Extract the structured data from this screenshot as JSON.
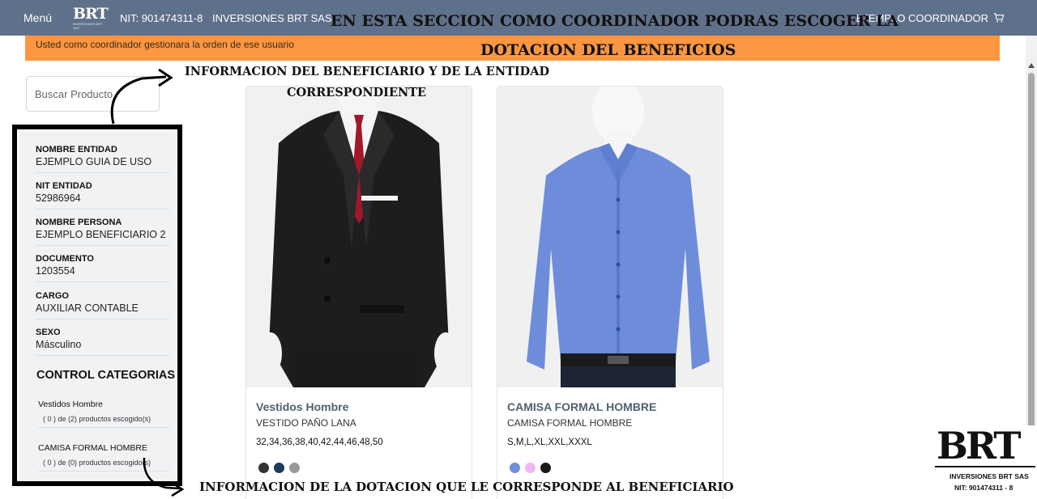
{
  "navbar": {
    "menu_label": "Menú",
    "logo_text": "BRT",
    "logo_subtext": "INVERSIONES BRT SAS",
    "nit": "NIT: 901474311-8",
    "company": "INVERSIONES BRT SAS",
    "user": "EJEMPLO COORDINADOR",
    "cart_icon": "cart-icon"
  },
  "banner": {
    "text": "Usted como coordinador gestionara la orden de ese usuario",
    "color": "#fd9640"
  },
  "search": {
    "placeholder": "Buscar Producto"
  },
  "sidebar": {
    "fields": [
      {
        "label": "NOMBRE ENTIDAD",
        "value": "EJEMPLO GUIA DE USO"
      },
      {
        "label": "NIT ENTIDAD",
        "value": "52986964"
      },
      {
        "label": "NOMBRE PERSONA",
        "value": "EJEMPLO BENEFICIARIO 2"
      },
      {
        "label": "DOCUMENTO",
        "value": "1203554"
      },
      {
        "label": "CARGO",
        "value": "AUXILIAR CONTABLE"
      },
      {
        "label": "SEXO",
        "value": "Másculino"
      }
    ],
    "categories_heading": "CONTROL CATEGORIAS",
    "categories": [
      {
        "name": "Vestidos Hombre",
        "count": "( 0 ) de (2) productos escogido(s)"
      },
      {
        "name": "CAMISA FORMAL HOMBRE",
        "count": "( 0 ) de (0) productos escogido(s)"
      }
    ]
  },
  "products": [
    {
      "title": "Vestidos Hombre",
      "subtitle": "VESTIDO PAÑO LANA",
      "sizes": "32,34,36,38,40,42,44,46,48,50",
      "colors": [
        "#333333",
        "#1e3a5f",
        "#9a9a9a"
      ]
    },
    {
      "title": "CAMISA FORMAL HOMBRE",
      "subtitle": "CAMISA FORMAL HOMBRE",
      "sizes": "S,M,L,XL,XXL,XXXL",
      "colors": [
        "#6f8fd8",
        "#f0b6f0",
        "#1a1a1a"
      ]
    }
  ],
  "annotations": {
    "top_line1": "EN ESTA SECCION COMO COORDINADOR PODRAS ESCOGER LA",
    "top_line2": "DOTACION DEL BENEFICIOS",
    "mid_line1": "INFORMACION DEL BENEFICIARIO Y DE LA ENTIDAD",
    "mid_line2": "CORRESPONDIENTE",
    "bottom": "INFORMACION DE LA DOTACION QUE LE CORRESPONDE AL BENEFICIARIO"
  },
  "corner_logo": {
    "mark": "BRT",
    "line1": "INVERSIONES BRT SAS",
    "line2": "NIT: 901474311 - 8"
  }
}
